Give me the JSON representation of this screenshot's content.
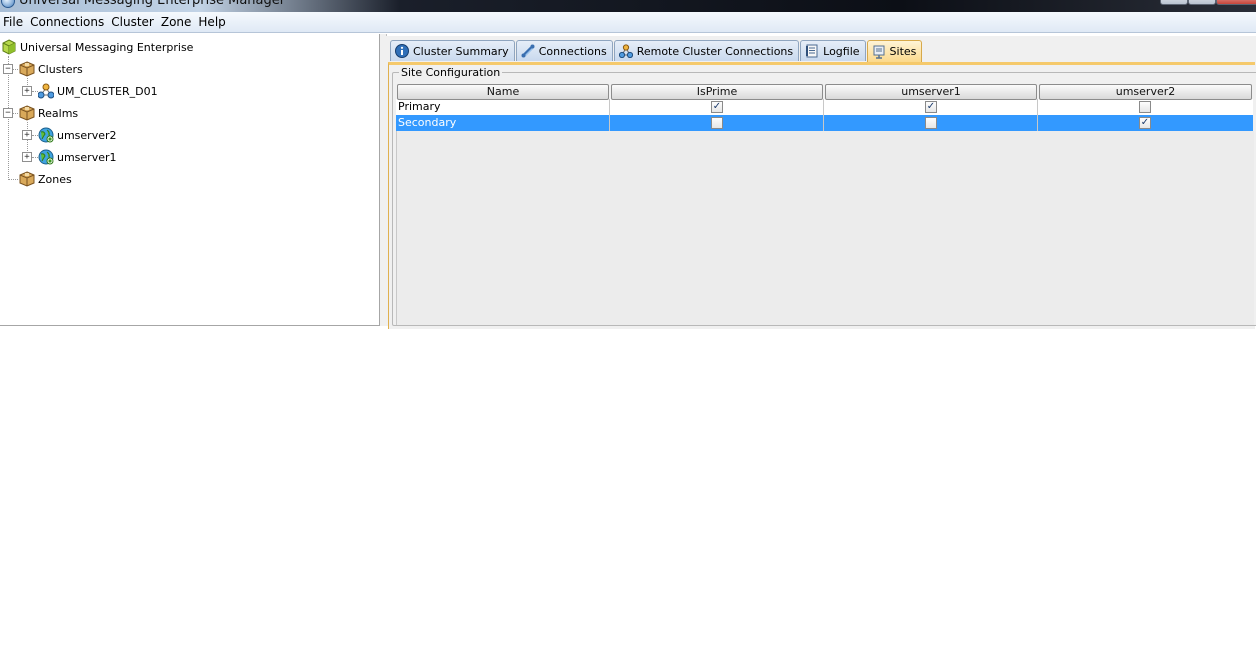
{
  "window": {
    "title": "Universal Messaging Enterprise Manager"
  },
  "menubar": {
    "items": [
      "File",
      "Connections",
      "Cluster",
      "Zone",
      "Help"
    ]
  },
  "tree": {
    "root": "Universal Messaging Enterprise",
    "clusters": "Clusters",
    "cluster_item": "UM_CLUSTER_D01",
    "realms": "Realms",
    "realm_items": [
      "umserver2",
      "umserver1"
    ],
    "zones": "Zones"
  },
  "tabs": [
    {
      "label": "Cluster Summary",
      "icon": "info-icon"
    },
    {
      "label": "Connections",
      "icon": "connections-icon"
    },
    {
      "label": "Remote Cluster Connections",
      "icon": "remote-cluster-icon"
    },
    {
      "label": "Logfile",
      "icon": "logfile-icon"
    },
    {
      "label": "Sites",
      "icon": "sites-icon",
      "active": true
    }
  ],
  "site_config": {
    "group_title": "Site Configuration",
    "columns": [
      "Name",
      "IsPrime",
      "umserver1",
      "umserver2"
    ],
    "rows": [
      {
        "name": "Primary",
        "isprime": true,
        "umserver1": true,
        "umserver2": false,
        "selected": false
      },
      {
        "name": "Secondary",
        "isprime": false,
        "umserver1": false,
        "umserver2": true,
        "selected": true
      }
    ]
  },
  "colors": {
    "selection": "#3399ff",
    "active_tab": "#fbd98c"
  }
}
